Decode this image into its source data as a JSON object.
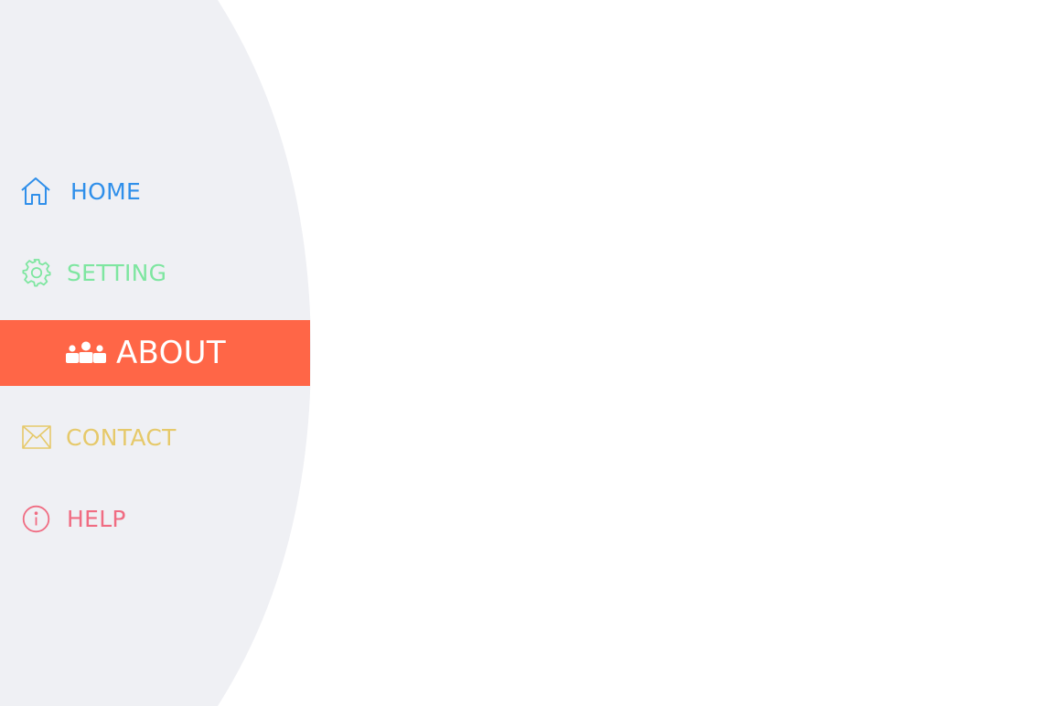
{
  "colors": {
    "sidebar_bg": "#eff0f4",
    "home": "#2f8fea",
    "setting": "#7ee6a0",
    "about_bg": "#ff6647",
    "about_text": "#ffffff",
    "contact": "#e6c96a",
    "help": "#f06c82"
  },
  "menu": {
    "items": [
      {
        "label": "HOME",
        "icon": "home-icon"
      },
      {
        "label": "SETTING",
        "icon": "gear-icon"
      },
      {
        "label": "ABOUT",
        "icon": "people-icon",
        "active": true
      },
      {
        "label": "CONTACT",
        "icon": "envelope-icon"
      },
      {
        "label": "HELP",
        "icon": "info-icon"
      }
    ]
  }
}
